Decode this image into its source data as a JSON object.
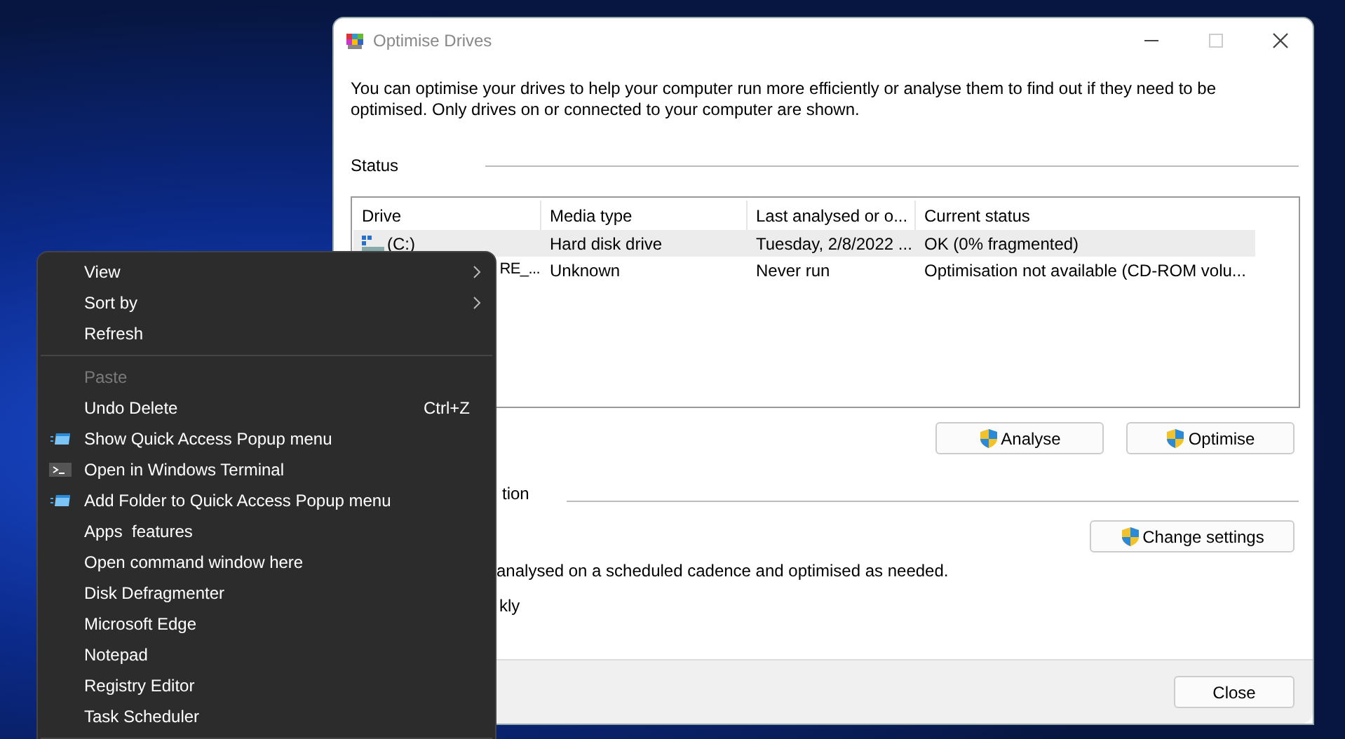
{
  "window": {
    "title": "Optimise Drives",
    "description": "You can optimise your drives to help your computer run more efficiently or analyse them to find out if they need to be optimised. Only drives on or connected to your computer are shown.",
    "status_heading": "Status",
    "table": {
      "columns": [
        "Drive",
        "Media type",
        "Last analysed or o...",
        "Current status"
      ],
      "rows": [
        {
          "cells": [
            "(C:)",
            "Hard disk drive",
            "Tuesday, 2/8/2022 ...",
            "OK (0% fragmented)"
          ],
          "selected": true,
          "kind": "hdd"
        },
        {
          "cells": [
            "RE_...",
            "Unknown",
            "Never run",
            "Optimisation not available (CD-ROM volu..."
          ],
          "selected": false,
          "kind": "hidden"
        }
      ]
    },
    "action_buttons": [
      "Analyse",
      "Optimise"
    ],
    "section_heading": "tion",
    "settings_button": "Change settings",
    "schedule_text": "analysed on a scheduled cadence and optimised as needed.",
    "frequency_text": "kly",
    "close_button": "Close"
  },
  "context_menu": {
    "groups": [
      [
        {
          "label": "View",
          "kind": "submenu",
          "disabled": false
        },
        {
          "label": "Sort by",
          "kind": "submenu",
          "disabled": false
        },
        {
          "label": "Refresh",
          "kind": "plain",
          "disabled": false
        }
      ],
      [
        {
          "label": "Paste",
          "kind": "plain",
          "disabled": true
        },
        {
          "label": "Undo Delete",
          "kind": "plain",
          "disabled": false,
          "shortcut": "Ctrl+Z"
        },
        {
          "label": "Show Quick Access Popup menu",
          "kind": "quick-access",
          "disabled": false
        },
        {
          "label": "Open in Windows Terminal",
          "kind": "terminal",
          "disabled": false
        },
        {
          "label": "Add Folder to Quick Access Popup menu",
          "kind": "quick-access",
          "disabled": false
        },
        {
          "label": "Apps  features",
          "kind": "plain",
          "disabled": false
        },
        {
          "label": "Open command window here",
          "kind": "plain",
          "disabled": false
        },
        {
          "label": "Disk Defragmenter",
          "kind": "plain",
          "disabled": false
        },
        {
          "label": "Microsoft Edge",
          "kind": "plain",
          "disabled": false
        },
        {
          "label": "Notepad",
          "kind": "plain",
          "disabled": false
        },
        {
          "label": "Registry Editor",
          "kind": "plain",
          "disabled": false
        },
        {
          "label": "Task Scheduler",
          "kind": "plain",
          "disabled": false
        }
      ]
    ]
  }
}
